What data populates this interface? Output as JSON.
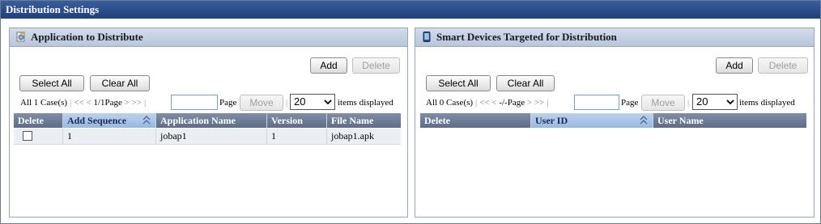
{
  "window": {
    "title": "Distribution Settings"
  },
  "left_panel": {
    "title": "Application to Distribute",
    "icon": "application-icon",
    "add_label": "Add",
    "delete_label": "Delete",
    "select_all_label": "Select All",
    "clear_all_label": "Clear All",
    "pager": {
      "count": "All 1 Case(s)",
      "first": "<<",
      "prev": "<",
      "page_info": "1/1Page",
      "next": ">",
      "last": ">>",
      "page_input": "",
      "page_label": "Page",
      "move_label": "Move",
      "per_page": "20",
      "per_page_suffix": "items displayed"
    },
    "columns": [
      "Delete",
      "Add Sequence",
      "Application Name",
      "Version",
      "File Name"
    ],
    "sorted_column": "Add Sequence",
    "rows": [
      {
        "delete_checked": false,
        "add_sequence": "1",
        "application_name": "jobap1",
        "version": "1",
        "file_name": "jobap1.apk"
      }
    ]
  },
  "right_panel": {
    "title": "Smart Devices Targeted for Distribution",
    "icon": "smart-device-icon",
    "add_label": "Add",
    "delete_label": "Delete",
    "select_all_label": "Select All",
    "clear_all_label": "Clear All",
    "pager": {
      "count": "All 0 Case(s)",
      "first": "<<",
      "prev": "<",
      "page_info": "-/-Page",
      "next": ">",
      "last": ">>",
      "page_input": "",
      "page_label": "Page",
      "move_label": "Move",
      "per_page": "20",
      "per_page_suffix": "items displayed"
    },
    "columns": [
      "Delete",
      "User ID",
      "User Name"
    ],
    "sorted_column": "User ID",
    "rows": []
  },
  "colors": {
    "titlebar": "#1f3f7a",
    "panel_header": "#c6d1e4",
    "table_header": "#6b7a93",
    "sorted_header": "#a9c4e8"
  }
}
